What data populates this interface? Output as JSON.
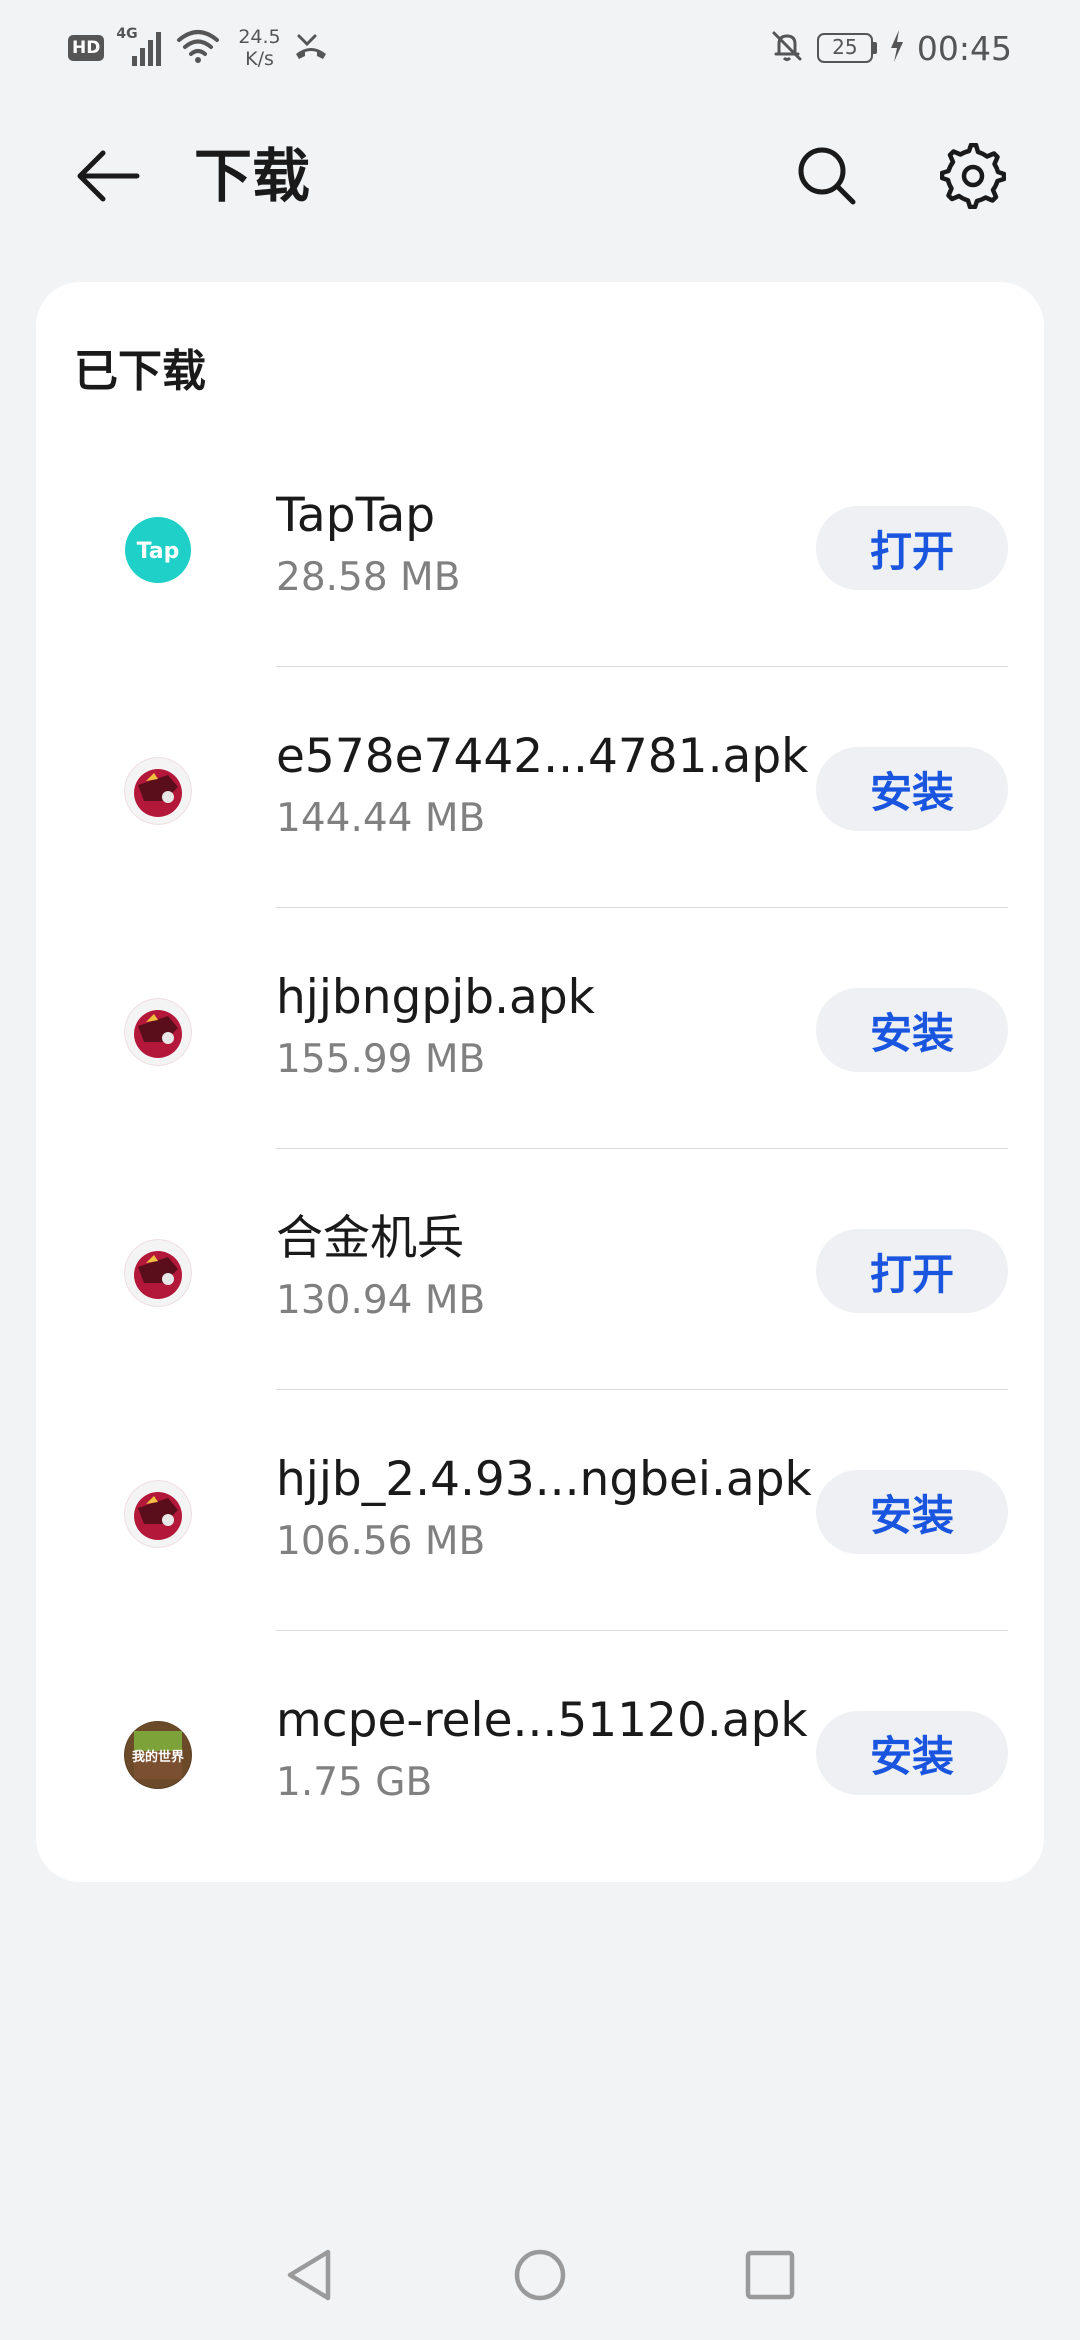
{
  "status_bar": {
    "hd": "HD",
    "network": "4G",
    "speed_value": "24.5",
    "speed_unit": "K/s",
    "battery": "25",
    "time": "00:45"
  },
  "header": {
    "title": "下载"
  },
  "section": {
    "title": "已下载"
  },
  "downloads": [
    {
      "name": "TapTap",
      "size": "28.58 MB",
      "action": "打开",
      "icon": "taptap-icon"
    },
    {
      "name": "e578e7442...4781.apk",
      "size": "144.44 MB",
      "action": "安装",
      "icon": "game-icon"
    },
    {
      "name": "hjjbngpjb.apk",
      "size": "155.99 MB",
      "action": "安装",
      "icon": "game-icon"
    },
    {
      "name": "合金机兵",
      "size": "130.94 MB",
      "action": "打开",
      "icon": "game-icon"
    },
    {
      "name": "hjjb_2.4.93...ngbei.apk",
      "size": "106.56 MB",
      "action": "安装",
      "icon": "game-icon"
    },
    {
      "name": "mcpe-rele...51120.apk",
      "size": "1.75 GB",
      "action": "安装",
      "icon": "minecraft-icon"
    }
  ],
  "taptap_logo_text": "Tap",
  "mc_logo_text": "我的世界",
  "colors": {
    "accent": "#1a55e0",
    "taptap": "#1ed0c8",
    "background": "#f1f3f5"
  }
}
